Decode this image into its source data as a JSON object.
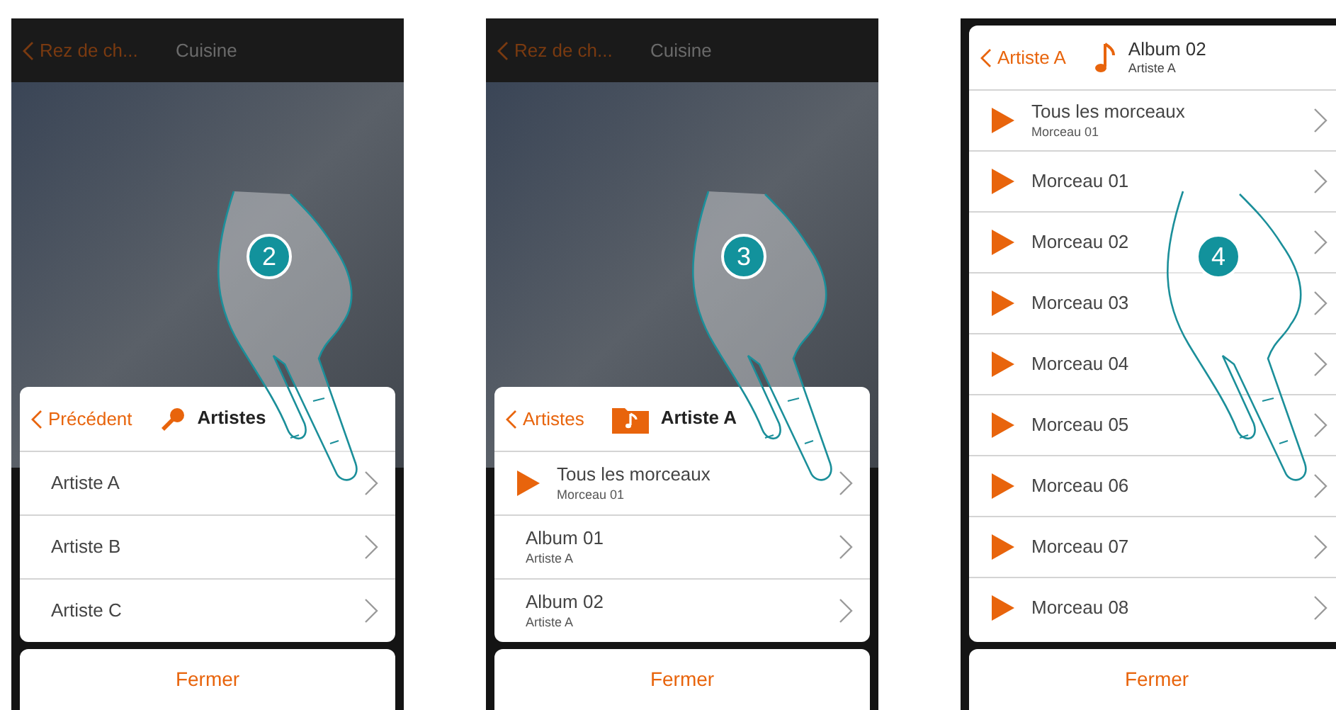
{
  "screens": [
    {
      "step": "2",
      "top_bar": {
        "back": "Rez de ch...",
        "title": "Cuisine"
      },
      "panel": {
        "back": "Précédent",
        "kind": "microphone",
        "title": "Artistes",
        "rows": [
          {
            "kind": "plain",
            "title": "Artiste A"
          },
          {
            "kind": "plain",
            "title": "Artiste B"
          },
          {
            "kind": "plain",
            "title": "Artiste C"
          }
        ]
      },
      "close_button": "Fermer"
    },
    {
      "step": "3",
      "top_bar": {
        "back": "Rez de ch...",
        "title": "Cuisine"
      },
      "panel": {
        "back": "Artistes",
        "kind": "folder-note",
        "title": "Artiste A",
        "rows": [
          {
            "kind": "play",
            "title": "Tous les morceaux",
            "subtitle": "Morceau 01"
          },
          {
            "kind": "plain",
            "title": "Album 01",
            "subtitle": "Artiste A"
          },
          {
            "kind": "plain",
            "title": "Album 02",
            "subtitle": "Artiste A"
          }
        ]
      },
      "close_button": "Fermer"
    },
    {
      "step": "4",
      "panel": {
        "back": "Artiste A",
        "kind": "note",
        "title": "Album 02",
        "subtitle": "Artiste A",
        "rows": [
          {
            "kind": "play",
            "title": "Tous les morceaux",
            "subtitle": "Morceau 01"
          },
          {
            "kind": "play",
            "title": "Morceau 01"
          },
          {
            "kind": "play",
            "title": "Morceau 02"
          },
          {
            "kind": "play",
            "title": "Morceau 03"
          },
          {
            "kind": "play",
            "title": "Morceau 04"
          },
          {
            "kind": "play",
            "title": "Morceau 05"
          },
          {
            "kind": "play",
            "title": "Morceau 06"
          },
          {
            "kind": "play",
            "title": "Morceau 07"
          },
          {
            "kind": "play",
            "title": "Morceau 08"
          }
        ]
      },
      "close_button": "Fermer"
    }
  ]
}
